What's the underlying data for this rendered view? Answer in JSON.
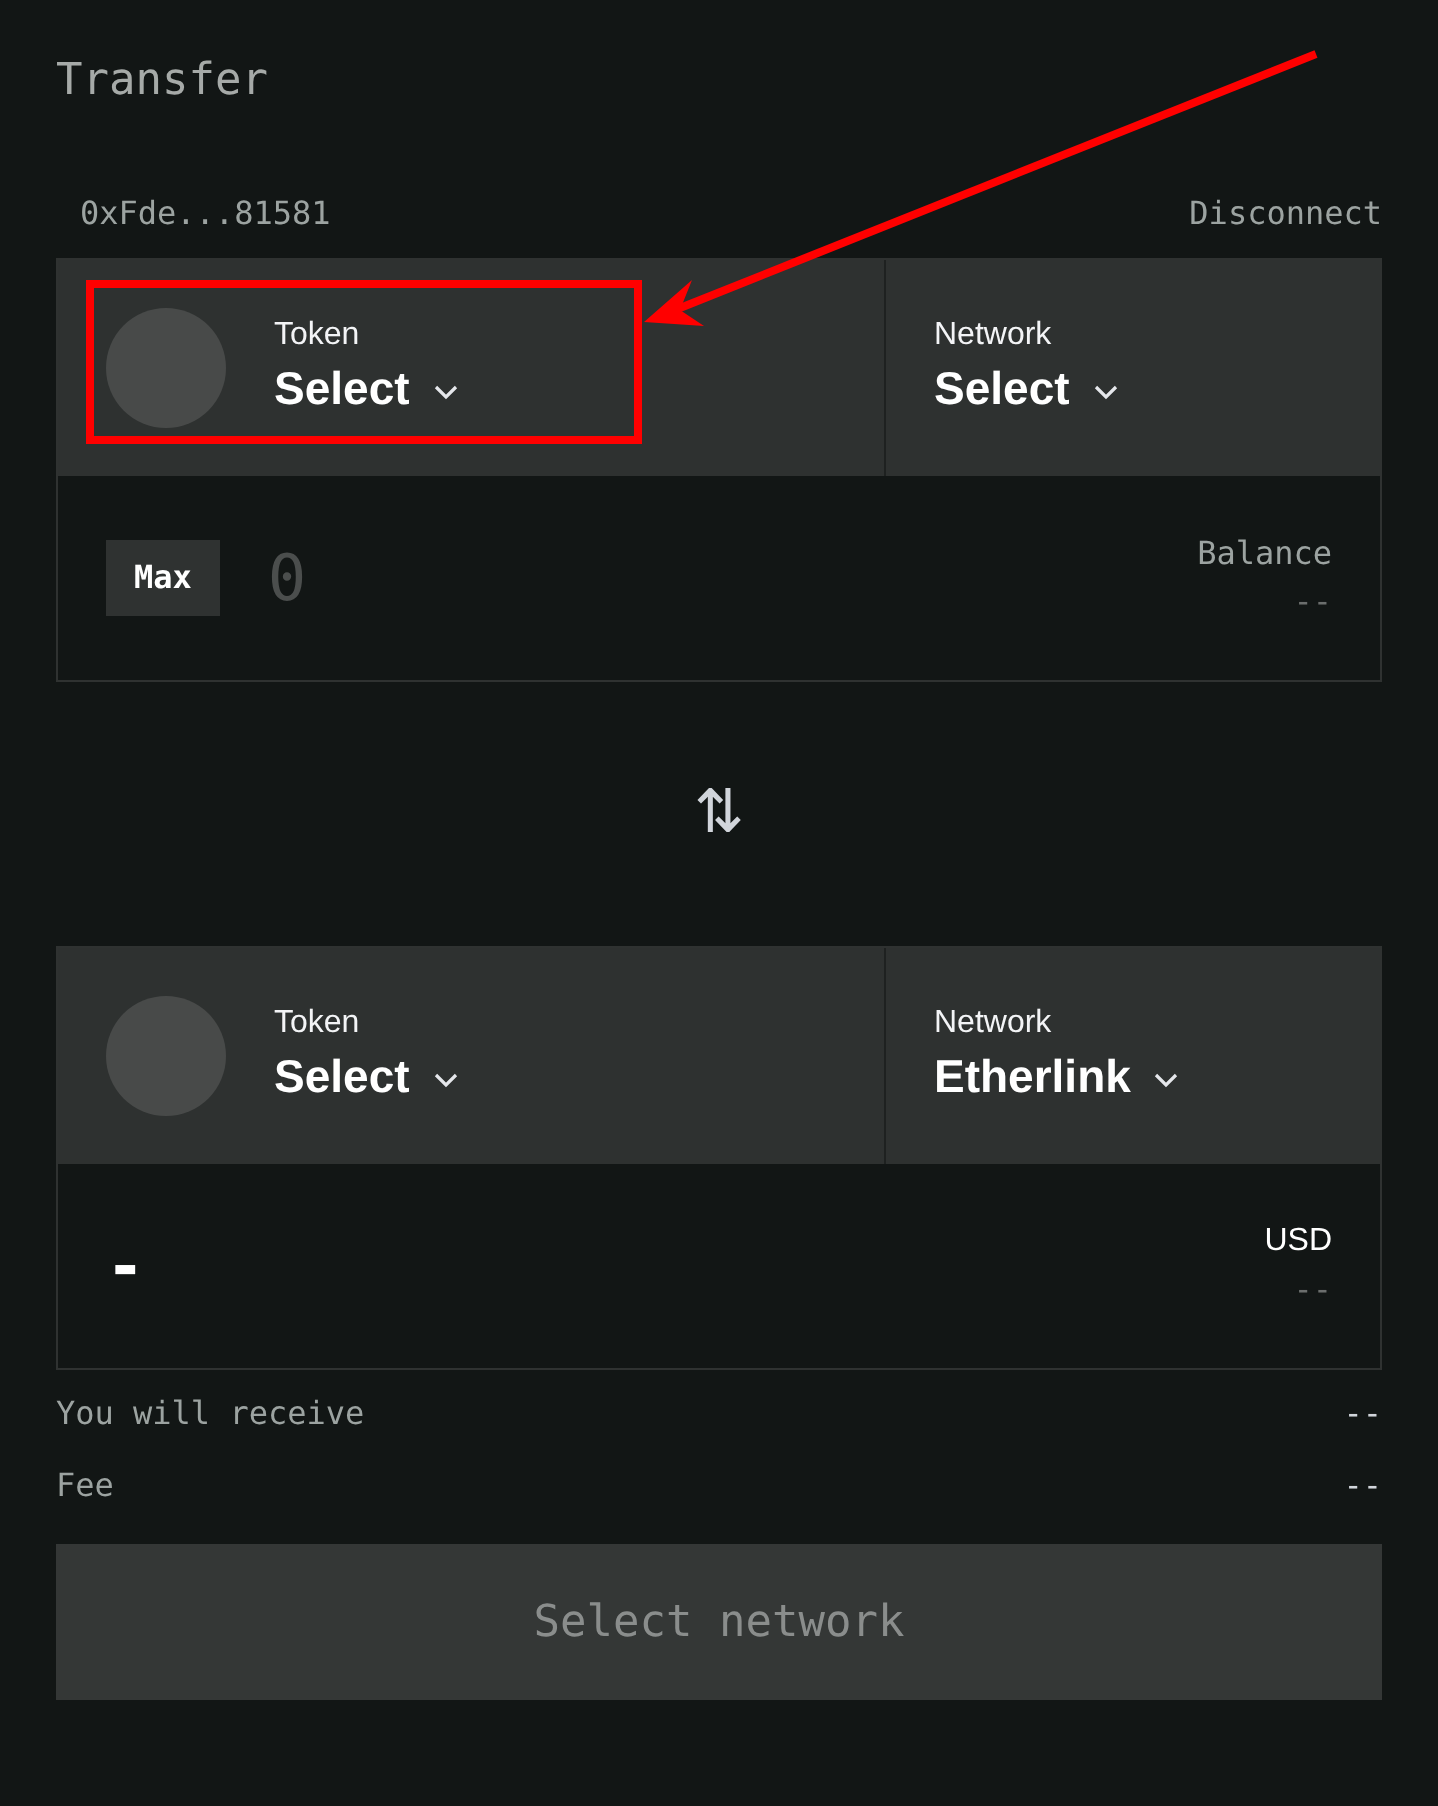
{
  "title": "Transfer",
  "account": {
    "address": "0xFde...81581",
    "disconnect": "Disconnect"
  },
  "from": {
    "token_label": "Token",
    "token_value": "Select",
    "network_label": "Network",
    "network_value": "Select",
    "max": "Max",
    "amount_placeholder": "0",
    "balance_label": "Balance",
    "balance_value": "--"
  },
  "swap_symbol": "⇅",
  "to": {
    "token_label": "Token",
    "token_value": "Select",
    "network_label": "Network",
    "network_value": "Etherlink",
    "amount": "-",
    "usd_label": "USD",
    "usd_value": "--"
  },
  "summary": [
    {
      "label": "You will receive",
      "value": "--"
    },
    {
      "label": "Fee",
      "value": "--"
    }
  ],
  "submit": {
    "label": "Select network",
    "disabled": true
  },
  "annotation": {
    "highlight": true
  }
}
